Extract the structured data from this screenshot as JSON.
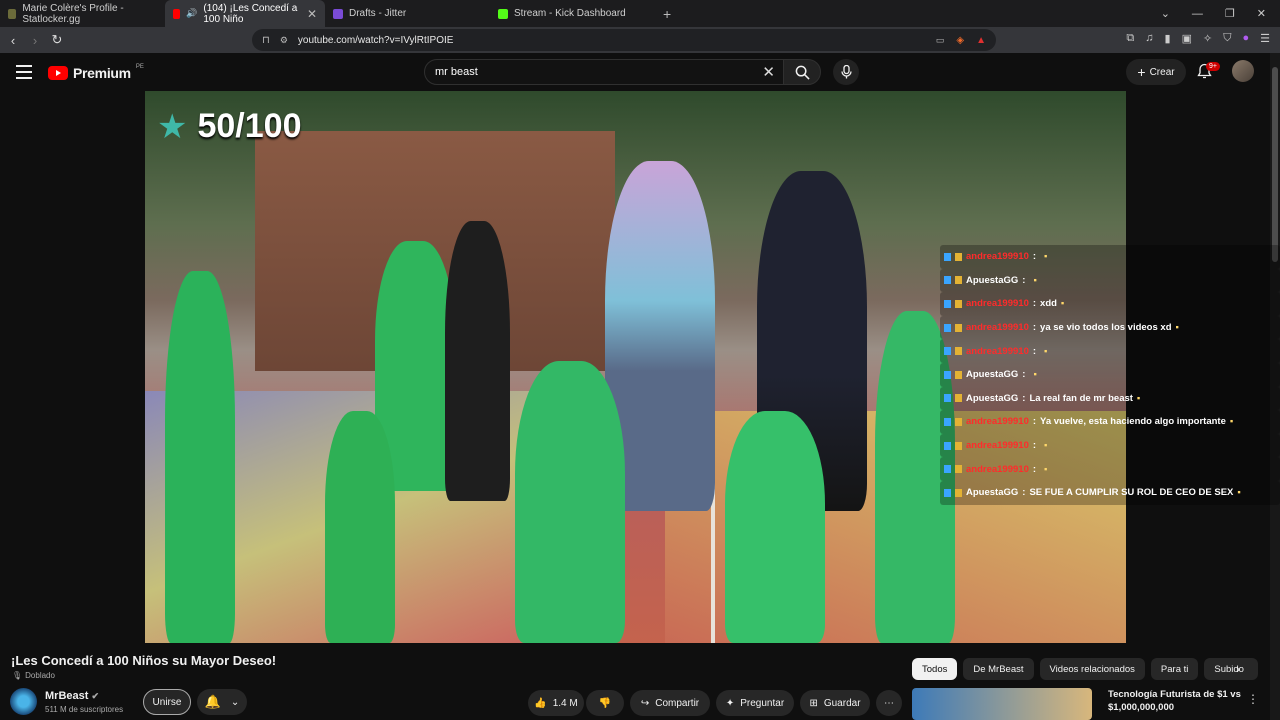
{
  "browser": {
    "tabs": [
      {
        "label": "Marie Colère's Profile - Statlocker.gg",
        "active": false,
        "fav": "#6b6b3a"
      },
      {
        "label": "(104) ¡Les Concedí a 100 Niño",
        "active": true,
        "fav": "#ff0000"
      },
      {
        "label": "Drafts - Jitter",
        "active": false,
        "fav": "#7a4bd6"
      },
      {
        "label": "Stream - Kick Dashboard",
        "active": false,
        "fav": "#53fc18"
      }
    ],
    "url": "youtube.com/watch?v=IVylRtIPOIE"
  },
  "youtube": {
    "logo_text": "Premium",
    "logo_region": "PE",
    "search_query": "mr beast",
    "create_label": "Crear",
    "notif_badge": "9+"
  },
  "video": {
    "counter": "50/100",
    "chat": [
      {
        "user": "andrea199910",
        "text": "",
        "user_color": "red"
      },
      {
        "user": "ApuestaGG",
        "text": "",
        "user_color": "white"
      },
      {
        "user": "andrea199910",
        "text": "xdd",
        "user_color": "red"
      },
      {
        "user": "andrea199910",
        "text": "ya se vio todos los videos xd",
        "user_color": "red"
      },
      {
        "user": "andrea199910",
        "text": "",
        "user_color": "red"
      },
      {
        "user": "ApuestaGG",
        "text": "",
        "user_color": "white"
      },
      {
        "user": "ApuestaGG",
        "text": "La real fan de mr beast",
        "user_color": "white"
      },
      {
        "user": "andrea199910",
        "text": "Ya vuelve, esta haciendo algo importante",
        "user_color": "red"
      },
      {
        "user": "andrea199910",
        "text": "",
        "user_color": "red"
      },
      {
        "user": "andrea199910",
        "text": "",
        "user_color": "red"
      },
      {
        "user": "ApuestaGG",
        "text": "SE FUE A CUMPLIR SU ROL DE CEO DE SEX",
        "user_color": "white"
      }
    ]
  },
  "watch": {
    "title": "¡Les Concedí a 100 Niños su Mayor Deseo!",
    "dubbed": "Doblado",
    "channel": "MrBeast",
    "subscribers": "511 M de suscriptores",
    "join_label": "Unirse",
    "likes": "1.4 M",
    "share_label": "Compartir",
    "ask_label": "Preguntar",
    "save_label": "Guardar"
  },
  "sidebar": {
    "chips": [
      "Todos",
      "De MrBeast",
      "Videos relacionados",
      "Para ti",
      "Subido"
    ],
    "rec_title": "Tecnología Futurista de $1 vs $1,000,000,000"
  }
}
